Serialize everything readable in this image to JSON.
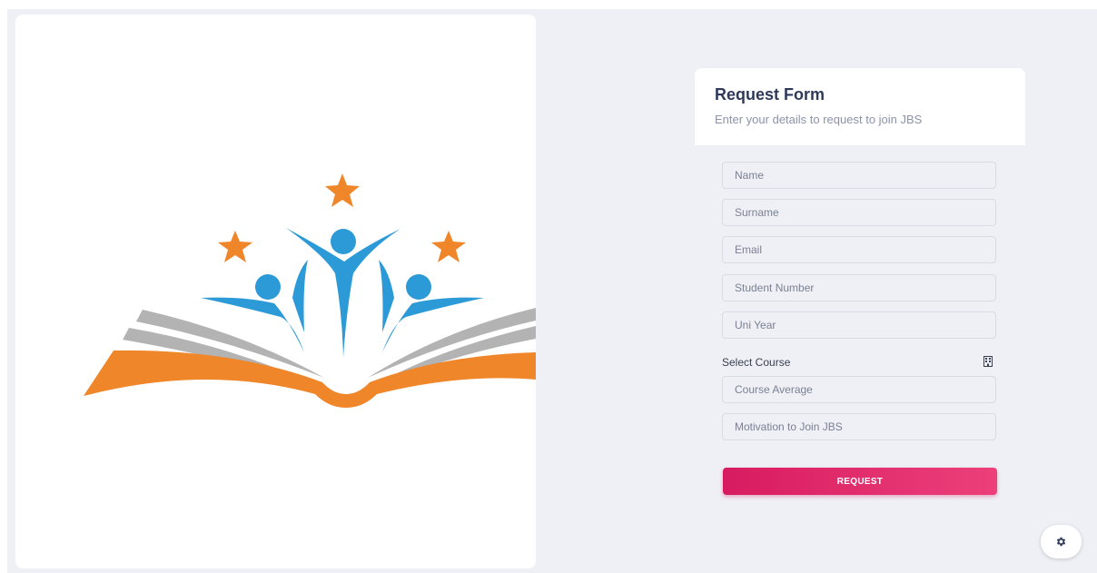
{
  "form": {
    "title": "Request Form",
    "subtitle": "Enter your details to request to join JBS",
    "fields": {
      "name": {
        "placeholder": "Name",
        "value": ""
      },
      "surname": {
        "placeholder": "Surname",
        "value": ""
      },
      "email": {
        "placeholder": "Email",
        "value": ""
      },
      "student_number": {
        "placeholder": "Student Number",
        "value": ""
      },
      "uni_year": {
        "placeholder": "Uni Year",
        "value": ""
      },
      "course_average": {
        "placeholder": "Course Average",
        "value": ""
      },
      "motivation": {
        "placeholder": "Motivation to Join JBS",
        "value": ""
      }
    },
    "select_course_label": "Select Course",
    "select_course_icon": "building-icon",
    "submit_label": "REQUEST"
  },
  "settings_icon": "gear-icon",
  "colors": {
    "accent": "#e0256a",
    "page_background": "#eef0f5",
    "title": "#2f3a5a",
    "logo_orange": "#f0862a",
    "logo_blue": "#2b9ad6",
    "logo_gray": "#b3b3b3"
  }
}
